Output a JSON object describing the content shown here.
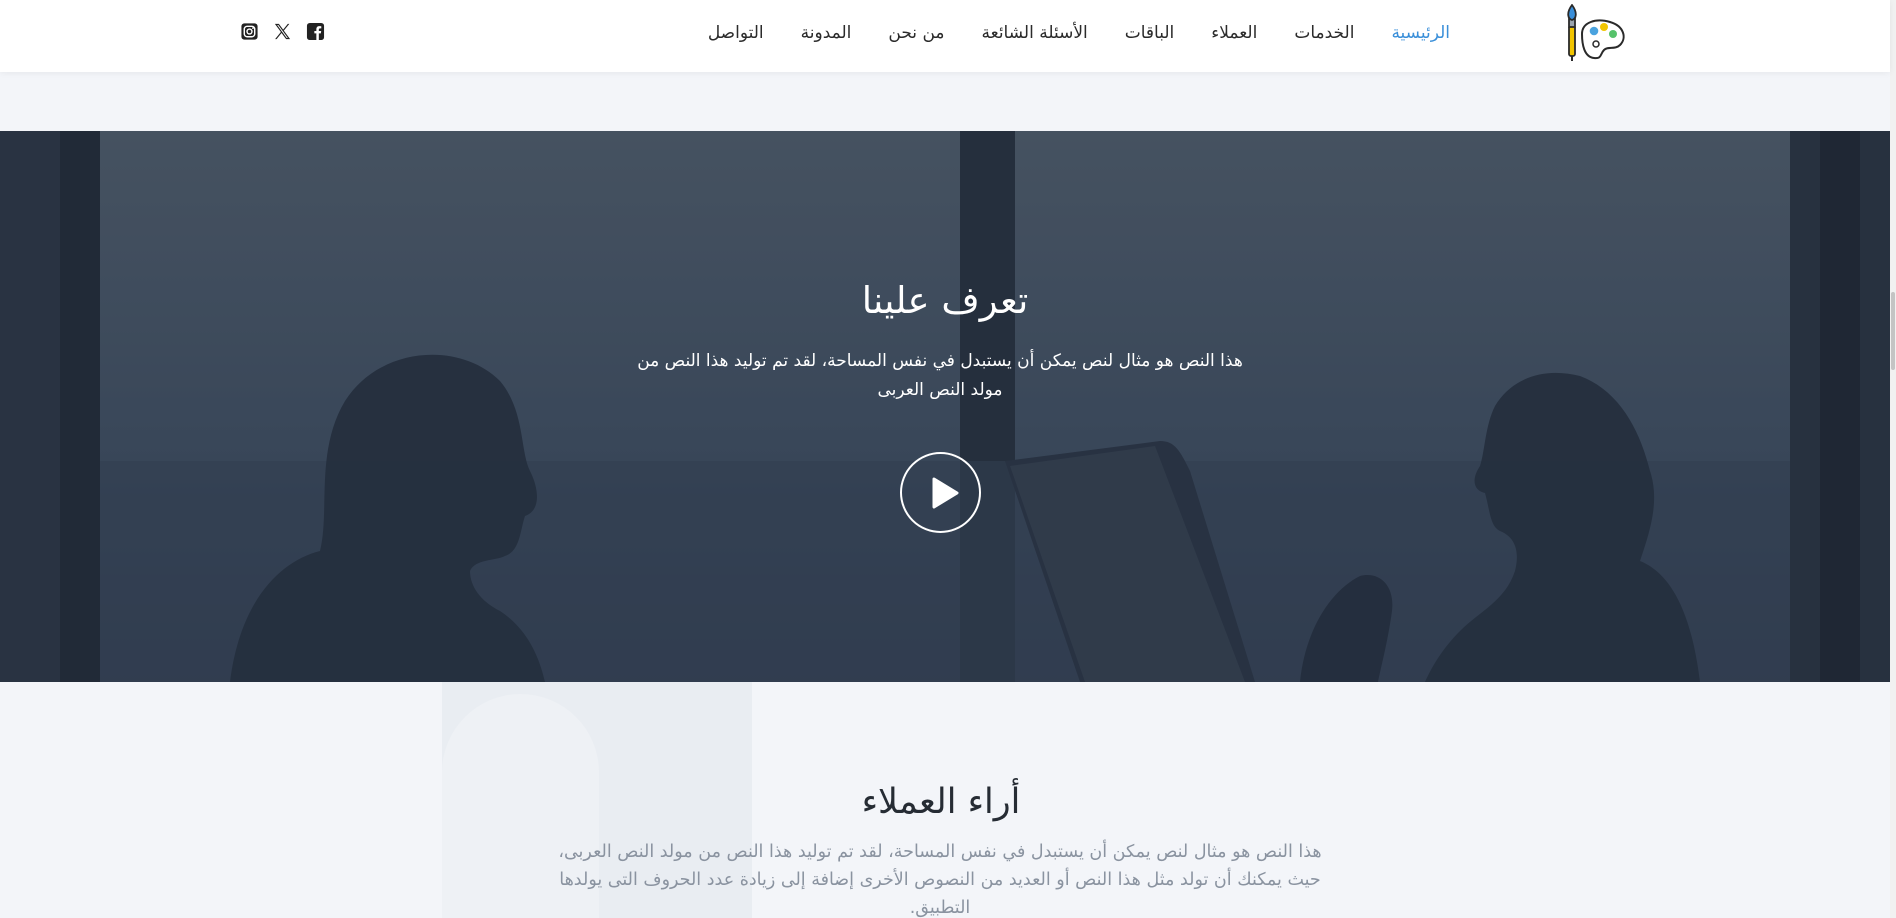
{
  "header": {
    "logo_icon": "palette-brush-icon",
    "nav": [
      {
        "label": "الرئيسية",
        "active": true
      },
      {
        "label": "الخدمات",
        "active": false
      },
      {
        "label": "العملاء",
        "active": false
      },
      {
        "label": "الباقات",
        "active": false
      },
      {
        "label": "الأسئلة الشائعة",
        "active": false
      },
      {
        "label": "من نحن",
        "active": false
      },
      {
        "label": "المدونة",
        "active": false
      },
      {
        "label": "التواصل",
        "active": false
      }
    ],
    "socials": [
      "facebook-icon",
      "x-twitter-icon",
      "instagram-icon"
    ],
    "active_color": "#3a8fd9"
  },
  "hero": {
    "title": "تعرف علينا",
    "text_line1": "هذا النص هو مثال لنص يمكن أن يستبدل في نفس المساحة، لقد تم توليد هذا النص من",
    "text_line2": "مولد النص العربى",
    "play_icon": "play-icon"
  },
  "reviews": {
    "title": "أراء العملاء",
    "text_line1": "هذا النص هو مثال لنص يمكن أن يستبدل في نفس المساحة، لقد تم توليد هذا النص من مولد النص العربى،",
    "text_line2": "حيث يمكنك أن تولد مثل هذا النص أو العديد من النصوص الأخرى إضافة إلى زيادة عدد الحروف التى يولدها",
    "text_line3": "التطبيق."
  }
}
